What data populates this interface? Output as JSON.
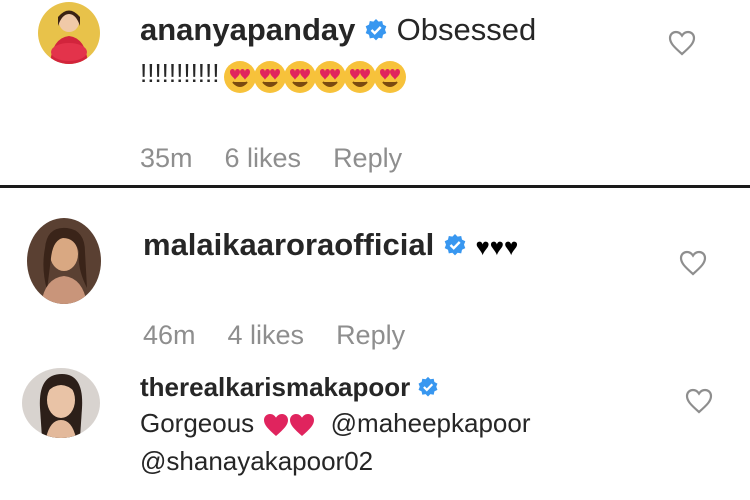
{
  "comments": [
    {
      "username": "ananyapanday",
      "text": "Obsessed",
      "text_line2": "!!!!!!!!!!!",
      "emoji": "heart-eyes-face x6",
      "time": "35m",
      "likes": "6 likes",
      "reply": "Reply"
    },
    {
      "username": "malaikaaroraofficial",
      "text": "♥♥♥",
      "time": "46m",
      "likes": "4 likes",
      "reply": "Reply"
    },
    {
      "username": "therealkarismakapoor",
      "text": "Gorgeous",
      "emoji": "red-heart x2",
      "mention1": "@maheepkapoor",
      "mention2": "@shanayakapoor02"
    }
  ],
  "icons": {
    "verified": "verified-badge-icon",
    "like": "heart-outline-icon"
  },
  "colors": {
    "verified_blue": "#3897f0",
    "meta_gray": "#8e8e8e",
    "emoji_yellow": "#f7c23b",
    "heart_red": "#e0245e"
  }
}
